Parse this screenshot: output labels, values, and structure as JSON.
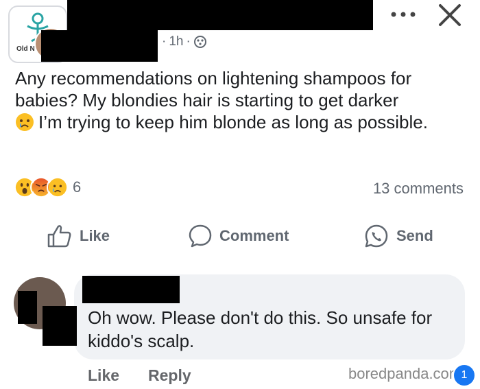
{
  "post": {
    "group_avatar_label": "Old N",
    "time": "1h",
    "separator": "·",
    "more_icon": "more-dots-icon",
    "close_icon": "close-icon",
    "text_line1": "Any recommendations on lightening shampoos for babies? My blondies hair is starting to get darker",
    "text_line2": "I’m trying to keep him blonde as long as possible.",
    "reaction_count": "6",
    "comments_count": "13 comments",
    "reactions": [
      "wow",
      "angry",
      "sad"
    ]
  },
  "actions": {
    "like": "Like",
    "comment": "Comment",
    "send": "Send"
  },
  "comment": {
    "text": "Oh wow. Please don't do this. So unsafe for kiddo's scalp.",
    "like": "Like",
    "reply": "Reply"
  },
  "watermark": "boredpanda.com",
  "badge": "1",
  "colors": {
    "accent": "#1877f2",
    "muted": "#606770",
    "bubble": "#f0f2f5"
  }
}
